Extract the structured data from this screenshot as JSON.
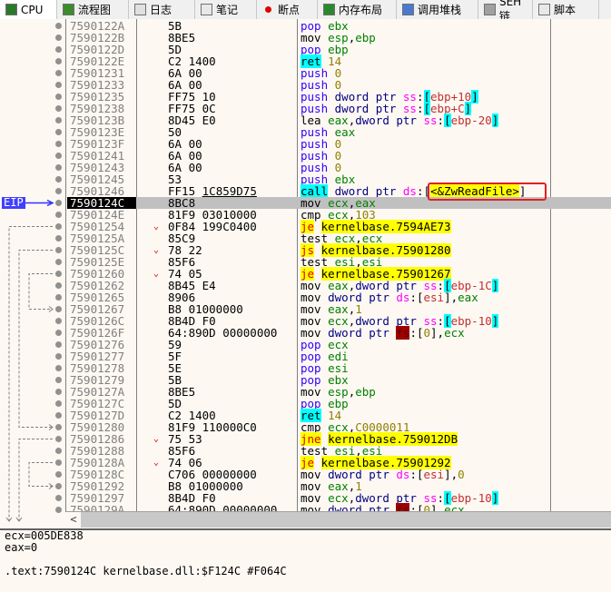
{
  "tabs": [
    {
      "label": "CPU",
      "icon": "cpu-chip-icon",
      "active": true
    },
    {
      "label": "流程图",
      "icon": "tree-icon"
    },
    {
      "label": "日志",
      "icon": "log-pencil-icon"
    },
    {
      "label": "笔记",
      "icon": "notes-icon"
    },
    {
      "label": "断点",
      "icon": "breakpoint-dot-icon"
    },
    {
      "label": "内存布局",
      "icon": "memory-icon"
    },
    {
      "label": "调用堆栈",
      "icon": "call-stack-icon"
    },
    {
      "label": "SEH链",
      "icon": "seh-chain-icon"
    },
    {
      "label": "脚本",
      "icon": "script-icon"
    }
  ],
  "eip_label": "EIP",
  "eip_index": 15,
  "rows": [
    {
      "addr": "7590122A",
      "bytes": "5B",
      "mn": "pop",
      "ops": "ebx"
    },
    {
      "addr": "7590122B",
      "bytes": "8BE5",
      "mn": "mov",
      "ops": "esp,ebp"
    },
    {
      "addr": "7590122D",
      "bytes": "5D",
      "mn": "pop",
      "ops": "ebp"
    },
    {
      "addr": "7590122E",
      "bytes": "C2 1400",
      "mn": "ret",
      "ops": "14"
    },
    {
      "addr": "75901231",
      "bytes": "6A 00",
      "mn": "push",
      "ops": "0"
    },
    {
      "addr": "75901233",
      "bytes": "6A 00",
      "mn": "push",
      "ops": "0"
    },
    {
      "addr": "75901235",
      "bytes": "FF75 10",
      "mn": "push",
      "ops": "dword ptr ss:[ebp+10]"
    },
    {
      "addr": "75901238",
      "bytes": "FF75 0C",
      "mn": "push",
      "ops": "dword ptr ss:[ebp+C]"
    },
    {
      "addr": "7590123B",
      "bytes": "8D45 E0",
      "mn": "lea",
      "ops": "eax,dword ptr ss:[ebp-20]"
    },
    {
      "addr": "7590123E",
      "bytes": "50",
      "mn": "push",
      "ops": "eax"
    },
    {
      "addr": "7590123F",
      "bytes": "6A 00",
      "mn": "push",
      "ops": "0"
    },
    {
      "addr": "75901241",
      "bytes": "6A 00",
      "mn": "push",
      "ops": "0"
    },
    {
      "addr": "75901243",
      "bytes": "6A 00",
      "mn": "push",
      "ops": "0"
    },
    {
      "addr": "75901245",
      "bytes": "53",
      "mn": "push",
      "ops": "ebx"
    },
    {
      "addr": "75901246",
      "bytes": "FF15 1C859D75",
      "mn": "call",
      "ops": "dword ptr ds:[<&ZwReadFile>]"
    },
    {
      "addr": "7590124C",
      "bytes": "8BC8",
      "mn": "mov",
      "ops": "ecx,eax"
    },
    {
      "addr": "7590124E",
      "bytes": "81F9 03010000",
      "mn": "cmp",
      "ops": "ecx,103"
    },
    {
      "addr": "75901254",
      "bytes": "0F84 199C0400",
      "mn": "je",
      "ops": "kernelbase.7594AE73",
      "jump": true
    },
    {
      "addr": "7590125A",
      "bytes": "85C9",
      "mn": "test",
      "ops": "ecx,ecx"
    },
    {
      "addr": "7590125C",
      "bytes": "78 22",
      "mn": "js",
      "ops": "kernelbase.75901280",
      "jump": true
    },
    {
      "addr": "7590125E",
      "bytes": "85F6",
      "mn": "test",
      "ops": "esi,esi"
    },
    {
      "addr": "75901260",
      "bytes": "74 05",
      "mn": "je",
      "ops": "kernelbase.75901267",
      "jump": true
    },
    {
      "addr": "75901262",
      "bytes": "8B45 E4",
      "mn": "mov",
      "ops": "eax,dword ptr ss:[ebp-1C]"
    },
    {
      "addr": "75901265",
      "bytes": "8906",
      "mn": "mov",
      "ops": "dword ptr ds:[esi],eax"
    },
    {
      "addr": "75901267",
      "bytes": "B8 01000000",
      "mn": "mov",
      "ops": "eax,1"
    },
    {
      "addr": "7590126C",
      "bytes": "8B4D F0",
      "mn": "mov",
      "ops": "ecx,dword ptr ss:[ebp-10]"
    },
    {
      "addr": "7590126F",
      "bytes": "64:890D 00000000",
      "mn": "mov",
      "ops": "dword ptr fs:[0],ecx"
    },
    {
      "addr": "75901276",
      "bytes": "59",
      "mn": "pop",
      "ops": "ecx"
    },
    {
      "addr": "75901277",
      "bytes": "5F",
      "mn": "pop",
      "ops": "edi"
    },
    {
      "addr": "75901278",
      "bytes": "5E",
      "mn": "pop",
      "ops": "esi"
    },
    {
      "addr": "75901279",
      "bytes": "5B",
      "mn": "pop",
      "ops": "ebx"
    },
    {
      "addr": "7590127A",
      "bytes": "8BE5",
      "mn": "mov",
      "ops": "esp,ebp"
    },
    {
      "addr": "7590127C",
      "bytes": "5D",
      "mn": "pop",
      "ops": "ebp"
    },
    {
      "addr": "7590127D",
      "bytes": "C2 1400",
      "mn": "ret",
      "ops": "14"
    },
    {
      "addr": "75901280",
      "bytes": "81F9 110000C0",
      "mn": "cmp",
      "ops": "ecx,C0000011"
    },
    {
      "addr": "75901286",
      "bytes": "75 53",
      "mn": "jne",
      "ops": "kernelbase.759012DB",
      "jump": true
    },
    {
      "addr": "75901288",
      "bytes": "85F6",
      "mn": "test",
      "ops": "esi,esi"
    },
    {
      "addr": "7590128A",
      "bytes": "74 06",
      "mn": "je",
      "ops": "kernelbase.75901292",
      "jump": true
    },
    {
      "addr": "7590128C",
      "bytes": "C706 00000000",
      "mn": "mov",
      "ops": "dword ptr ds:[esi],0"
    },
    {
      "addr": "75901292",
      "bytes": "B8 01000000",
      "mn": "mov",
      "ops": "eax,1"
    },
    {
      "addr": "75901297",
      "bytes": "8B4D F0",
      "mn": "mov",
      "ops": "ecx,dword ptr ss:[ebp-10]"
    },
    {
      "addr": "7590129A",
      "bytes": "64:890D 00000000",
      "mn": "mov",
      "ops": "dword ptr fs:[0],ecx"
    }
  ],
  "branches": [
    {
      "from": 17,
      "to": null
    },
    {
      "from": 19,
      "to": 34
    },
    {
      "from": 21,
      "to": 24
    },
    {
      "from": 35,
      "to": null
    },
    {
      "from": 37,
      "to": 39
    }
  ],
  "highlighted_operand": "[<&ZwReadFile>]",
  "colors": {
    "eip_bg": "#4040ff",
    "jump_bg": "#ffff00",
    "call_bg": "#00ffff",
    "highlight_box": "#e02020"
  },
  "info": {
    "lines": [
      "ecx=005DE838",
      "eax=0",
      "",
      ".text:7590124C kernelbase.dll:$F124C #F064C"
    ]
  }
}
